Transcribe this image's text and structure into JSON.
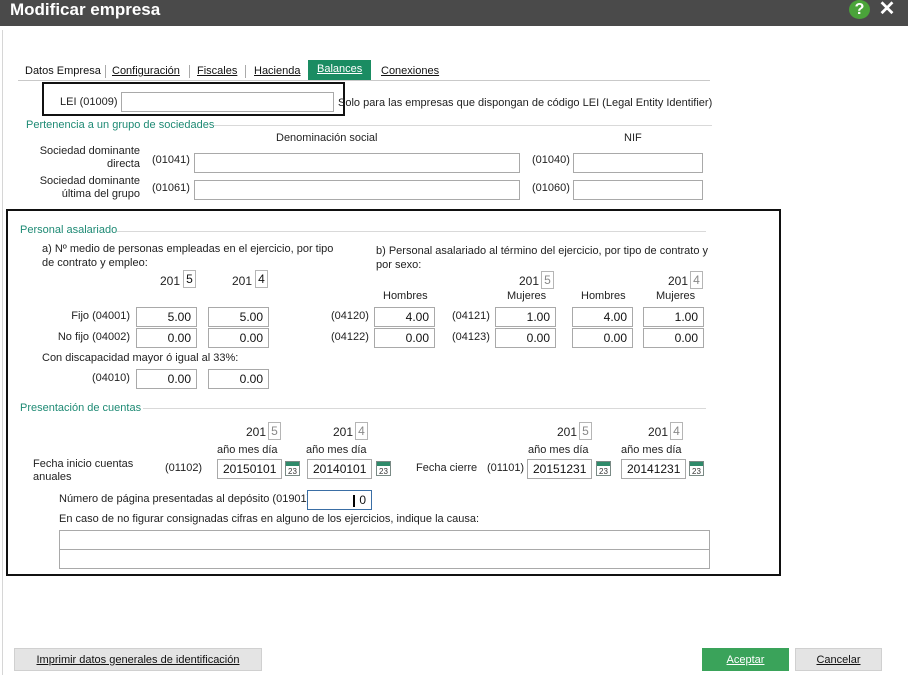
{
  "window": {
    "title": "Modificar empresa"
  },
  "tabs": [
    {
      "label": "Datos Empresa"
    },
    {
      "label": "Configuración"
    },
    {
      "label": "Fiscales"
    },
    {
      "label": "Hacienda"
    },
    {
      "label": "Balances"
    },
    {
      "label": "Conexiones"
    }
  ],
  "lei": {
    "label": "LEI (01009)",
    "value": "",
    "note": "Solo para las empresas que dispongan de código LEI (Legal Entity Identifier)"
  },
  "grupo": {
    "title": "Pertenencia a un grupo de sociedades",
    "col_denominacion": "Denominación social",
    "col_nif": "NIF",
    "rows": [
      {
        "label1": "Sociedad dominante",
        "label2": "directa",
        "code_den": "(01041)",
        "den": "",
        "code_nif": "(01040)",
        "nif": ""
      },
      {
        "label1": "Sociedad dominante",
        "label2": "última del grupo",
        "code_den": "(01061)",
        "den": "",
        "code_nif": "(01060)",
        "nif": ""
      }
    ]
  },
  "personal": {
    "title": "Personal asalariado",
    "a_title_1": "a) Nº medio de personas empleadas en el ejercicio, por tipo",
    "a_title_2": "de contrato y empleo:",
    "b_title_1": "b) Personal asalariado al término del ejercicio, por tipo de contrato y",
    "b_title_2": "por sexo:",
    "year_prefix": "201",
    "year1_digit": "5",
    "year2_digit": "4",
    "hombres": "Hombres",
    "mujeres": "Mujeres",
    "fijo": {
      "label": "Fijo (04001)",
      "y1": "5.00",
      "y2": "5.00",
      "code_h": "(04120)",
      "code_m": "(04121)",
      "h1": "4.00",
      "m1": "1.00",
      "h2": "4.00",
      "m2": "1.00"
    },
    "nofijo": {
      "label": "No fijo (04002)",
      "y1": "0.00",
      "y2": "0.00",
      "code_h": "(04122)",
      "code_m": "(04123)",
      "h1": "0.00",
      "m1": "0.00",
      "h2": "0.00",
      "m2": "0.00"
    },
    "discap_label": "Con discapacidad mayor ó igual al 33%:",
    "discap_code": "(04010)",
    "discap_y1": "0.00",
    "discap_y2": "0.00"
  },
  "cuentas": {
    "title": "Presentación de cuentas",
    "year_prefix": "201",
    "year1_digit": "5",
    "year2_digit": "4",
    "fecha_fmt": "año mes día",
    "inicio_label_1": "Fecha inicio cuentas",
    "inicio_label_2": "anuales",
    "inicio_code": "(01102)",
    "inicio_y1": "20150101",
    "inicio_y2": "20140101",
    "cierre_label": "Fecha cierre",
    "cierre_code": "(01101)",
    "cierre_y1": "20151231",
    "cierre_y2": "20141231",
    "cal_day": "23",
    "paginas_label": "Número de página presentadas al depósito (01901)",
    "paginas_value": "0",
    "causa_label": "En caso de no figurar consignadas cifras en alguno de los ejercicios, indique la causa:",
    "causa_line1": "",
    "causa_line2": ""
  },
  "buttons": {
    "imprimir": "Imprimir datos generales de identificación",
    "aceptar": "Aceptar",
    "cancelar": "Cancelar"
  },
  "colors": {
    "accent": "#1a8c62",
    "section": "#1e8a74",
    "titlebar": "#4a4a4a",
    "ok_button": "#3aa35a"
  }
}
